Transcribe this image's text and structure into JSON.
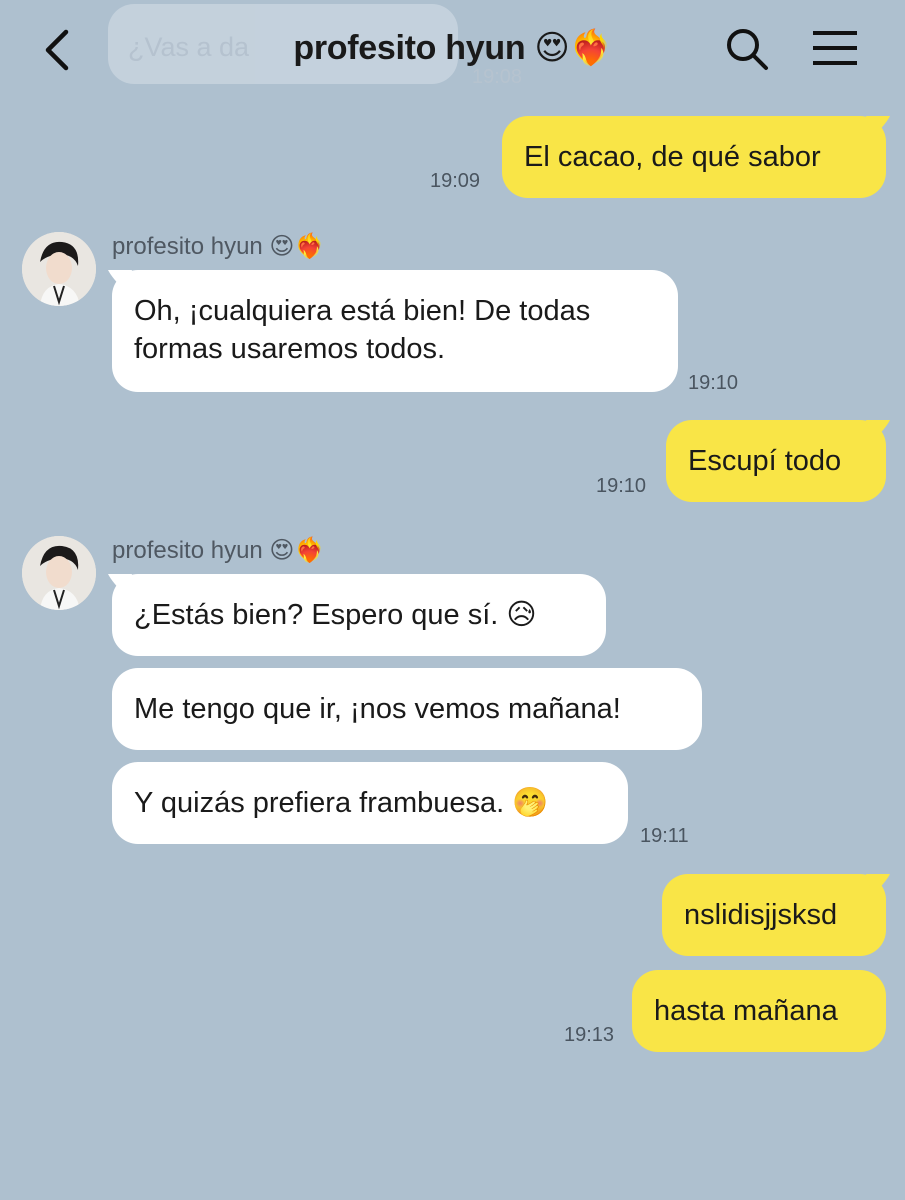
{
  "header": {
    "title": "profesito hyun 😍❤️‍🔥"
  },
  "ghost": {
    "text": "¿Vas a da",
    "time": "19:08"
  },
  "messages": {
    "m1": {
      "text": "El cacao, de qué sabor",
      "time": "19:09"
    },
    "m2": {
      "sender": "profesito hyun 😍❤️‍🔥",
      "line1": "Oh, ¡cualquiera está bien! De todas",
      "line2": "formas usaremos todos.",
      "time": "19:10"
    },
    "m3": {
      "text": "Escupí todo",
      "time": "19:10"
    },
    "m4": {
      "sender": "profesito hyun 😍❤️‍🔥",
      "text": "¿Estás bien? Espero que sí. 😥"
    },
    "m5": {
      "text": "Me tengo que ir, ¡nos vemos mañana!"
    },
    "m6": {
      "text": "Y quizás prefiera frambuesa. 🤭",
      "time": "19:11"
    },
    "m7": {
      "text": "nslidisjjsksd"
    },
    "m8": {
      "text": "hasta mañana",
      "time": "19:13"
    }
  },
  "colors": {
    "background": "#aec0cf",
    "my_bubble": "#f9e547",
    "their_bubble": "#ffffff"
  }
}
